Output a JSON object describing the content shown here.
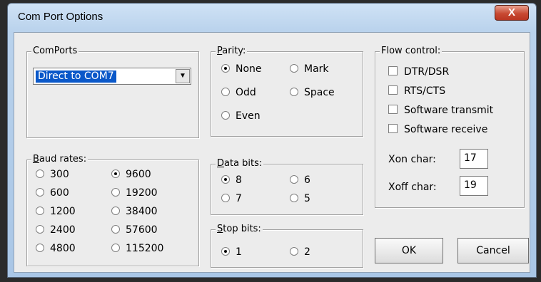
{
  "window": {
    "title": "Com Port Options",
    "close_label": "X"
  },
  "comports": {
    "label": "ComPorts",
    "selected": "Direct to COM7"
  },
  "parity": {
    "label": "Parity:",
    "options": [
      "None",
      "Mark",
      "Odd",
      "Space",
      "Even"
    ],
    "selected": "None"
  },
  "baud": {
    "label": "Baud rates:",
    "options": [
      "300",
      "9600",
      "600",
      "19200",
      "1200",
      "38400",
      "2400",
      "57600",
      "4800",
      "115200"
    ],
    "selected": "9600"
  },
  "data_bits": {
    "label": "Data bits:",
    "options": [
      "8",
      "6",
      "7",
      "5"
    ],
    "selected": "8"
  },
  "stop_bits": {
    "label": "Stop bits:",
    "options": [
      "1",
      "2"
    ],
    "selected": "1"
  },
  "flow": {
    "label": "Flow control:",
    "checks": [
      "DTR/DSR",
      "RTS/CTS",
      "Software transmit",
      "Software receive"
    ],
    "xon_label": "Xon char:",
    "xon_value": "17",
    "xoff_label": "Xoff char:",
    "xoff_value": "19"
  },
  "buttons": {
    "ok": "OK",
    "cancel": "Cancel"
  }
}
